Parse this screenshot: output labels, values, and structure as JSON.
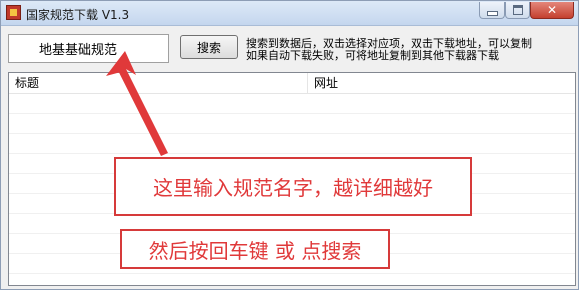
{
  "window": {
    "title": "国家规范下载 V1.3"
  },
  "search": {
    "value": "地基基础规范",
    "button_label": "搜索"
  },
  "help": {
    "line1": "搜索到数据后，双击选择对应项，双击下载地址，可以复制",
    "line2": "如果自动下载失败，可将地址复制到其他下载器下载"
  },
  "results": {
    "columns": [
      "标题",
      "网址"
    ]
  },
  "annotations": {
    "callout1": "这里输入规范名字，越详细越好",
    "callout2": "然后按回车键 或 点搜索",
    "accent_color": "#e0393a"
  }
}
